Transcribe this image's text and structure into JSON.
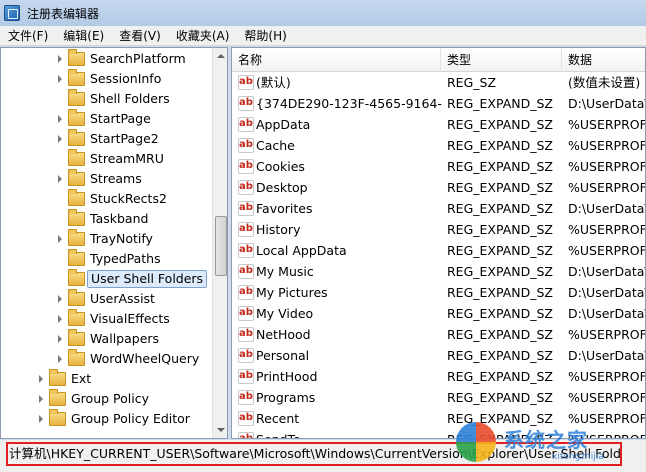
{
  "window": {
    "title": "注册表编辑器"
  },
  "menu": [
    "文件(F)",
    "编辑(E)",
    "查看(V)",
    "收藏夹(A)",
    "帮助(H)"
  ],
  "tree": [
    {
      "label": "SearchPlatform",
      "level": 2,
      "expandable": true
    },
    {
      "label": "SessionInfo",
      "level": 2,
      "expandable": true
    },
    {
      "label": "Shell Folders",
      "level": 2,
      "expandable": false
    },
    {
      "label": "StartPage",
      "level": 2,
      "expandable": true
    },
    {
      "label": "StartPage2",
      "level": 2,
      "expandable": true
    },
    {
      "label": "StreamMRU",
      "level": 2,
      "expandable": false
    },
    {
      "label": "Streams",
      "level": 2,
      "expandable": true
    },
    {
      "label": "StuckRects2",
      "level": 2,
      "expandable": false
    },
    {
      "label": "Taskband",
      "level": 2,
      "expandable": false
    },
    {
      "label": "TrayNotify",
      "level": 2,
      "expandable": true
    },
    {
      "label": "TypedPaths",
      "level": 2,
      "expandable": false
    },
    {
      "label": "User Shell Folders",
      "level": 2,
      "expandable": false,
      "selected": true
    },
    {
      "label": "UserAssist",
      "level": 2,
      "expandable": true
    },
    {
      "label": "VisualEffects",
      "level": 2,
      "expandable": true
    },
    {
      "label": "Wallpapers",
      "level": 2,
      "expandable": true
    },
    {
      "label": "WordWheelQuery",
      "level": 2,
      "expandable": true
    },
    {
      "label": "Ext",
      "level": 1,
      "expandable": true
    },
    {
      "label": "Group Policy",
      "level": 1,
      "expandable": true
    },
    {
      "label": "Group Policy Editor",
      "level": 1,
      "expandable": true
    }
  ],
  "list": {
    "columns": [
      "名称",
      "类型",
      "数据"
    ],
    "rows": [
      {
        "name": "(默认)",
        "type": "REG_SZ",
        "data": "(数值未设置)"
      },
      {
        "name": "{374DE290-123F-4565-9164-3...",
        "type": "REG_EXPAND_SZ",
        "data": "D:\\UserData\\"
      },
      {
        "name": "AppData",
        "type": "REG_EXPAND_SZ",
        "data": "%USERPROFIL"
      },
      {
        "name": "Cache",
        "type": "REG_EXPAND_SZ",
        "data": "%USERPROFIL"
      },
      {
        "name": "Cookies",
        "type": "REG_EXPAND_SZ",
        "data": "%USERPROFIL"
      },
      {
        "name": "Desktop",
        "type": "REG_EXPAND_SZ",
        "data": "%USERPROFIL"
      },
      {
        "name": "Favorites",
        "type": "REG_EXPAND_SZ",
        "data": "D:\\UserData\\"
      },
      {
        "name": "History",
        "type": "REG_EXPAND_SZ",
        "data": "%USERPROFIL"
      },
      {
        "name": "Local AppData",
        "type": "REG_EXPAND_SZ",
        "data": "%USERPROFIL"
      },
      {
        "name": "My Music",
        "type": "REG_EXPAND_SZ",
        "data": "D:\\UserData\\"
      },
      {
        "name": "My Pictures",
        "type": "REG_EXPAND_SZ",
        "data": "D:\\UserData\\"
      },
      {
        "name": "My Video",
        "type": "REG_EXPAND_SZ",
        "data": "D:\\UserData\\"
      },
      {
        "name": "NetHood",
        "type": "REG_EXPAND_SZ",
        "data": "%USERPROFIL"
      },
      {
        "name": "Personal",
        "type": "REG_EXPAND_SZ",
        "data": "D:\\UserData\\"
      },
      {
        "name": "PrintHood",
        "type": "REG_EXPAND_SZ",
        "data": "%USERPROFIL"
      },
      {
        "name": "Programs",
        "type": "REG_EXPAND_SZ",
        "data": "%USERPROFIL"
      },
      {
        "name": "Recent",
        "type": "REG_EXPAND_SZ",
        "data": "%USERPROFIL"
      },
      {
        "name": "SendTo",
        "type": "REG_EXPAND_SZ",
        "data": "%USERPROFIL"
      }
    ]
  },
  "statusbar": {
    "path": "计算机\\HKEY_CURRENT_USER\\Software\\Microsoft\\Windows\\CurrentVersion\\Explorer\\User Shell Folders"
  },
  "watermark": {
    "text": "系统之家",
    "url": "xitongzhijia"
  },
  "colors": {
    "highlight": "#e02020",
    "selected_bg": "#dcebfc",
    "selected_border": "#7da2ce"
  },
  "icons": {
    "folder": "folder-icon",
    "value": "reg-string-icon",
    "expander": "chevron-right-icon"
  }
}
